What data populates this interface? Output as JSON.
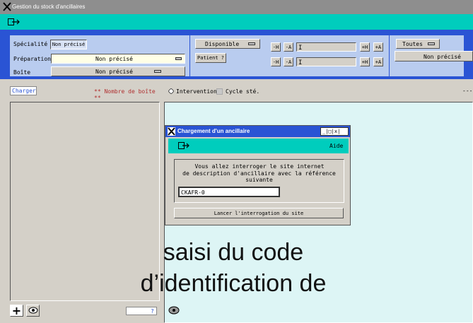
{
  "window": {
    "title": "Gestion du stock d'ancillaires"
  },
  "filters": {
    "specialite": {
      "label": "Spécialité",
      "value": "Non précisé"
    },
    "preparation": {
      "label": "Préparation",
      "value": "Non précisé"
    },
    "boite": {
      "label": "Boîte",
      "value": "Non précisé"
    },
    "disponible": "Disponible",
    "patient": "Patient ?",
    "toutes": "Toutes",
    "right_value": "Non précisé"
  },
  "steppers": {
    "left_a": "-H",
    "left_b": "-A",
    "right_a": "+H",
    "right_b": "+A"
  },
  "left_panel": {
    "charger": "Charger",
    "count_label": "** Nombre de boîte **"
  },
  "right_panel": {
    "intervention": "Intervention",
    "cycle": "Cycle sté.",
    "dashes": "---"
  },
  "dialog": {
    "title": "Chargement d'un ancillaire",
    "controls": "_|□|x|",
    "help": "Aide",
    "message_line1": "Vous allez interroger le site internet",
    "message_line2": "de description d'ancillaire avec la référence suivante",
    "input_value": "CKAFR-0",
    "launch_button": "Lancer l'interrogation du site"
  },
  "bottom": {
    "hidden_label": "?"
  },
  "caption": {
    "line1": "saisi du code",
    "line2": "d’identification de"
  },
  "colors": {
    "titlebar": "#8e8e8e",
    "toolbar": "#00cdbd",
    "accent_blue": "#2a54d4",
    "filter_bg": "#b9ccef",
    "panel_bg": "#d4d0c8",
    "list_bg": "#ddf5f5"
  }
}
